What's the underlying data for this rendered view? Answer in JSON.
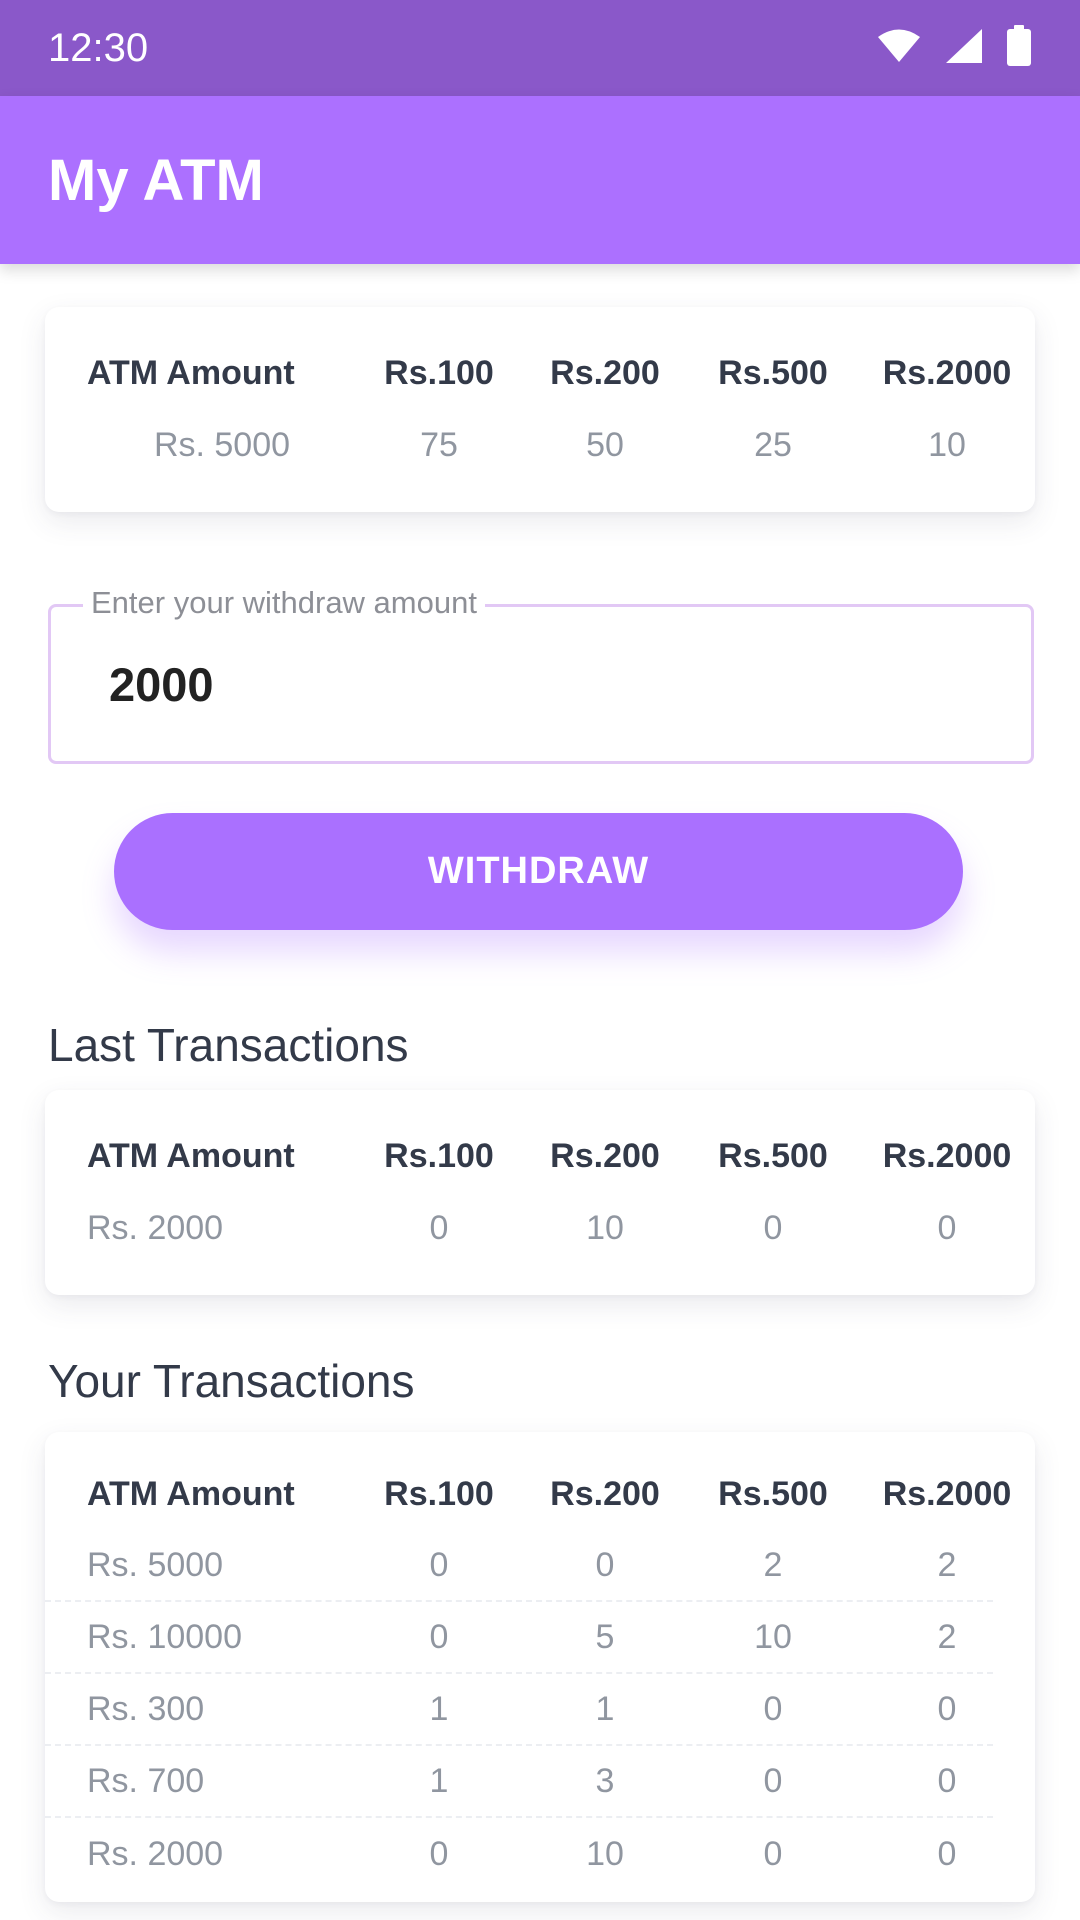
{
  "status_bar": {
    "time": "12:30",
    "icons": [
      "wifi-icon",
      "signal-icon",
      "battery-icon"
    ]
  },
  "app_bar": {
    "title": "My ATM"
  },
  "headers": [
    "ATM Amount",
    "Rs.100",
    "Rs.200",
    "Rs.500",
    "Rs.2000"
  ],
  "atm_status": {
    "row": [
      "Rs. 5000",
      "75",
      "50",
      "25",
      "10"
    ]
  },
  "withdraw_field": {
    "label": "Enter your withdraw amount",
    "value": "2000"
  },
  "withdraw_button": {
    "label": "WITHDRAW"
  },
  "last_transactions": {
    "title": "Last Transactions",
    "row": [
      "Rs. 2000",
      "0",
      "10",
      "0",
      "0"
    ]
  },
  "your_transactions": {
    "title": "Your Transactions",
    "rows": [
      [
        "Rs. 5000",
        "0",
        "0",
        "2",
        "2"
      ],
      [
        "Rs. 10000",
        "0",
        "5",
        "10",
        "2"
      ],
      [
        "Rs. 300",
        "1",
        "1",
        "0",
        "0"
      ],
      [
        "Rs. 700",
        "1",
        "3",
        "0",
        "0"
      ],
      [
        "Rs. 2000",
        "0",
        "10",
        "0",
        "0"
      ]
    ]
  },
  "colors": {
    "status_bar": "#8a58c9",
    "app_bar": "#ac70ff",
    "button": "#aa70ff",
    "field_border": "#e2c8f5",
    "header_text": "#333a49",
    "muted_text": "#9096a0"
  }
}
